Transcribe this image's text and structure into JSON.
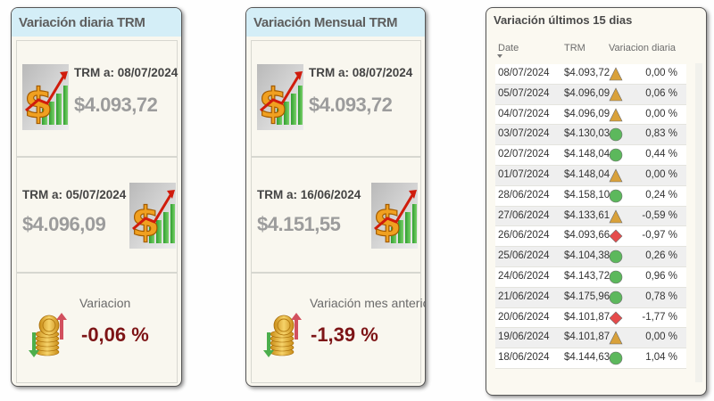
{
  "daily": {
    "title": "Variación diaria TRM",
    "current_label": "TRM a: 08/07/2024",
    "current_value": "$4.093,72",
    "previous_label": "TRM a: 05/07/2024",
    "previous_value": "$4.096,09",
    "variation_label": "Variacion",
    "variation_value": "-0,06 %"
  },
  "monthly": {
    "title": "Variación Mensual TRM",
    "current_label": "TRM a: 08/07/2024",
    "current_value": "$4.093,72",
    "previous_label": "TRM a: 16/06/2024",
    "previous_value": "$4.151,55",
    "variation_label": "Variación mes anterior",
    "variation_value": "-1,39 %"
  },
  "last15": {
    "title": "Variación últimos 15 dias",
    "columns": [
      "Date",
      "TRM",
      "Variacion diaria"
    ],
    "indicator_colors": {
      "triangle": "#d9a13a",
      "circle": "#5cb85c",
      "diamond": "#e54b4b"
    },
    "rows": [
      {
        "date": "08/07/2024",
        "trm": "$4.093,72",
        "indicator": "triangle",
        "pct": "0,00 %"
      },
      {
        "date": "05/07/2024",
        "trm": "$4.096,09",
        "indicator": "triangle",
        "pct": "0,06 %"
      },
      {
        "date": "04/07/2024",
        "trm": "$4.096,09",
        "indicator": "triangle",
        "pct": "0,00 %"
      },
      {
        "date": "03/07/2024",
        "trm": "$4.130,03",
        "indicator": "circle",
        "pct": "0,83 %"
      },
      {
        "date": "02/07/2024",
        "trm": "$4.148,04",
        "indicator": "circle",
        "pct": "0,44 %"
      },
      {
        "date": "01/07/2024",
        "trm": "$4.148,04",
        "indicator": "triangle",
        "pct": "0,00 %"
      },
      {
        "date": "28/06/2024",
        "trm": "$4.158,10",
        "indicator": "circle",
        "pct": "0,24 %"
      },
      {
        "date": "27/06/2024",
        "trm": "$4.133,61",
        "indicator": "triangle",
        "pct": "-0,59 %"
      },
      {
        "date": "26/06/2024",
        "trm": "$4.093,66",
        "indicator": "diamond",
        "pct": "-0,97 %"
      },
      {
        "date": "25/06/2024",
        "trm": "$4.104,38",
        "indicator": "circle",
        "pct": "0,26 %"
      },
      {
        "date": "24/06/2024",
        "trm": "$4.143,72",
        "indicator": "circle",
        "pct": "0,96 %"
      },
      {
        "date": "21/06/2024",
        "trm": "$4.175,96",
        "indicator": "circle",
        "pct": "0,78 %"
      },
      {
        "date": "20/06/2024",
        "trm": "$4.101,87",
        "indicator": "diamond",
        "pct": "-1,77 %"
      },
      {
        "date": "19/06/2024",
        "trm": "$4.101,87",
        "indicator": "triangle",
        "pct": "0,00 %"
      },
      {
        "date": "18/06/2024",
        "trm": "$4.144,63",
        "indicator": "circle",
        "pct": "1,04 %"
      }
    ]
  },
  "icons": {
    "money": "money-growth-chart-icon",
    "coins": "coins-up-down-arrows-icon"
  }
}
